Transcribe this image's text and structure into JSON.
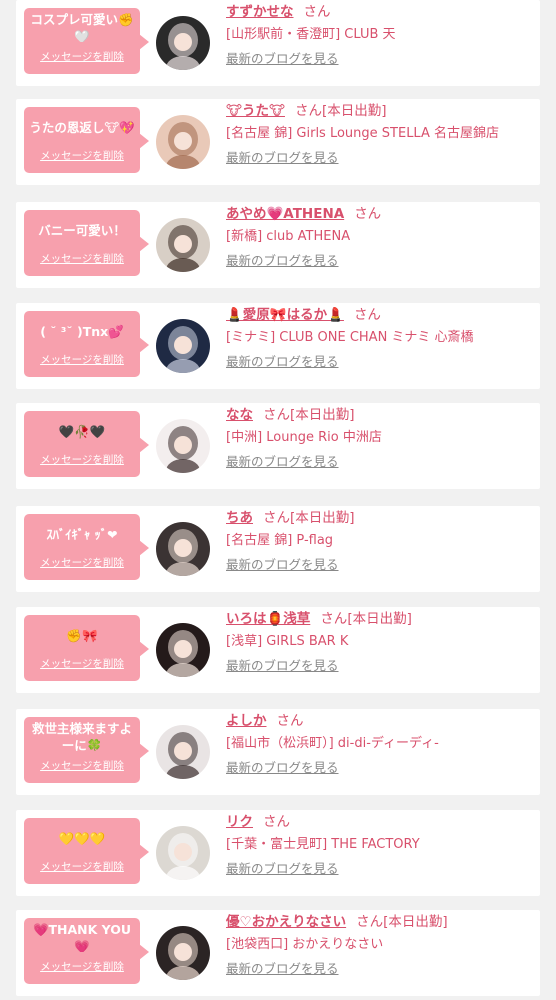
{
  "colors": {
    "accent": "#d8506c",
    "bubble": "#f7a0ad",
    "background": "#f1f1f1",
    "link_gray": "#888888"
  },
  "common": {
    "delete_label": "メッセージを削除",
    "blog_label": "最新のブログを見る",
    "san_label": "さん"
  },
  "messages": [
    {
      "message": "コスプレ可愛い✊🤍",
      "name": "すずかせな",
      "shift": "",
      "shop": "[山形駅前・香澄町] CLUB 天",
      "avatar_bg": "#2a2a2a",
      "avatar_fg": "#f0e6e6"
    },
    {
      "message": "うたの恩返し🐮💖",
      "name": "🐮うた🐮",
      "shift": "[本日出勤]",
      "shop": "[名古屋 錦] Girls Lounge STELLA 名古屋錦店",
      "avatar_bg": "#e9c9b8",
      "avatar_fg": "#a06a4e"
    },
    {
      "message": "バニー可愛い！",
      "name": "あやめ💗ATHENA",
      "shift": "",
      "shop": "[新橋] club ATHENA",
      "avatar_bg": "#d8cfc6",
      "avatar_fg": "#3b2a22"
    },
    {
      "message": "( ˘ ³˘ )Tnx💕",
      "name": "💄愛原🎀はるか💄",
      "shift": "",
      "shop": "[ミナミ] CLUB ONE CHAN ミナミ 心斎橋",
      "avatar_bg": "#1f2a44",
      "avatar_fg": "#c9cfe0"
    },
    {
      "message": "🖤🥀🖤",
      "name": "なな",
      "shift": "[本日出勤]",
      "shop": "[中洲] Lounge Rio 中洲店",
      "avatar_bg": "#f3eeee",
      "avatar_fg": "#3a2b2b"
    },
    {
      "message": "ｽﾊﾞｲｷﾞｬ ｯﾞ❤",
      "name": "ちあ",
      "shift": "[本日出勤]",
      "shop": "[名古屋 錦] P-flag",
      "avatar_bg": "#3b3333",
      "avatar_fg": "#e8d8d0"
    },
    {
      "message": "✊🎀",
      "name": "いろは🏮浅草",
      "shift": "[本日出勤]",
      "shop": "[浅草] GIRLS BAR K",
      "avatar_bg": "#241a1a",
      "avatar_fg": "#f2e4dc"
    },
    {
      "message": "救世主様来ますよーに🍀",
      "name": "よしか",
      "shift": "",
      "shop": "[福山市（松浜町）] di-di-ディーディ-",
      "avatar_bg": "#e9e4e4",
      "avatar_fg": "#3a2e2e"
    },
    {
      "message": "💛💛💛",
      "name": "リク",
      "shift": "",
      "shop": "[千葉・富士見町] THE FACTORY",
      "avatar_bg": "#dcd8d2",
      "avatar_fg": "#ffffff"
    },
    {
      "message": "💗THANK YOU💗",
      "name": "優♡おかえりなさい",
      "shift": "[本日出勤]",
      "shop": "[池袋西口] おかえりなさい",
      "avatar_bg": "#2b2424",
      "avatar_fg": "#eedcd2"
    }
  ]
}
